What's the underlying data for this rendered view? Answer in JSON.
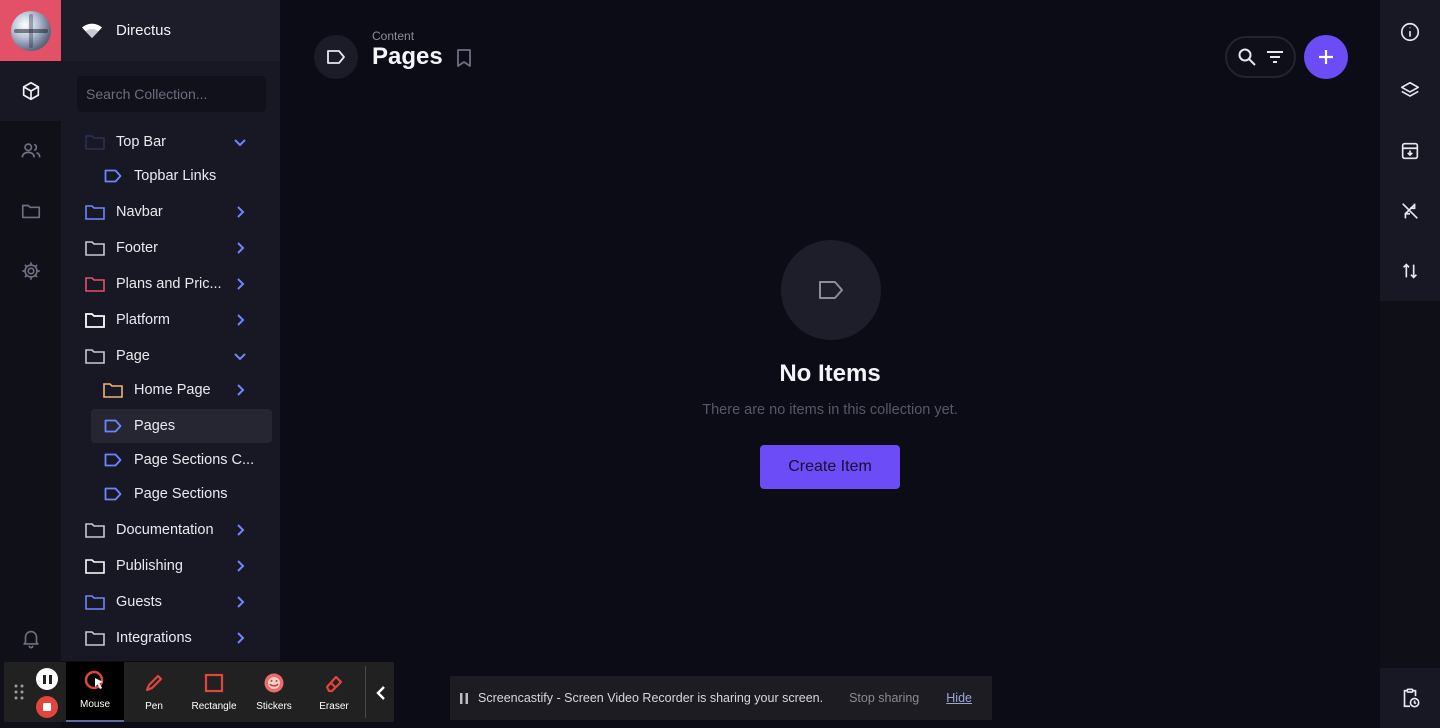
{
  "project": {
    "name": "Directus"
  },
  "search": {
    "placeholder": "Search Collection..."
  },
  "nav": {
    "items": [
      {
        "label": "Top Bar",
        "icon": "folder-icon",
        "expanded": true
      },
      {
        "label": "Topbar Links",
        "icon": "label-icon"
      },
      {
        "label": "Navbar",
        "icon": "folder-icon"
      },
      {
        "label": "Footer",
        "icon": "folder-icon"
      },
      {
        "label": "Plans and Pric...",
        "icon": "folder-icon"
      },
      {
        "label": "Platform",
        "icon": "folder-icon"
      },
      {
        "label": "Page",
        "icon": "folder-icon",
        "expanded": true
      },
      {
        "label": "Home Page",
        "icon": "folder-icon"
      },
      {
        "label": "Pages",
        "icon": "label-icon",
        "active": true
      },
      {
        "label": "Page Sections C...",
        "icon": "label-icon"
      },
      {
        "label": "Page Sections",
        "icon": "label-icon"
      },
      {
        "label": "Documentation",
        "icon": "folder-icon"
      },
      {
        "label": "Publishing",
        "icon": "folder-icon"
      },
      {
        "label": "Guests",
        "icon": "folder-icon"
      },
      {
        "label": "Integrations",
        "icon": "folder-icon"
      }
    ]
  },
  "header": {
    "breadcrumb": "Content",
    "title": "Pages"
  },
  "empty": {
    "title": "No Items",
    "text": "There are no items in this collection yet.",
    "button": "Create Item"
  },
  "recorder": {
    "tools": [
      "Mouse",
      "Pen",
      "Rectangle",
      "Stickers",
      "Eraser"
    ]
  },
  "share": {
    "message": "Screencastify - Screen Video Recorder is sharing your screen.",
    "stop": "Stop sharing",
    "hide": "Hide"
  },
  "colors": {
    "accent": "#6b4cf6",
    "logo_bg": "#e35169",
    "folder_blue": "#6f85ff",
    "folder_red": "#e35169",
    "folder_orange": "#f0b27c",
    "folder_white": "#ffffff",
    "folder_grey": "#c6c8d2"
  }
}
